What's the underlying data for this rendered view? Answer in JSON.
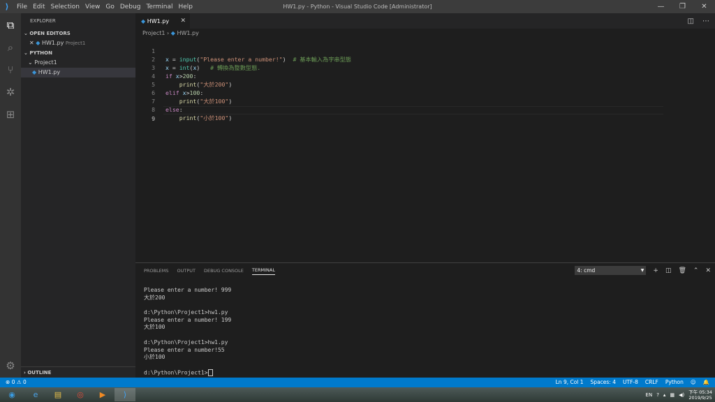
{
  "window": {
    "title": "HW1.py - Python - Visual Studio Code [Administrator]",
    "menu": [
      "File",
      "Edit",
      "Selection",
      "View",
      "Go",
      "Debug",
      "Terminal",
      "Help"
    ]
  },
  "sidebar": {
    "title": "EXPLORER",
    "open_editors_label": "OPEN EDITORS",
    "open_file": "HW1.py",
    "open_file_folder": "Project1",
    "workspace_label": "PYTHON",
    "folder": "Project1",
    "file": "HW1.py",
    "outline_label": "OUTLINE"
  },
  "tab": {
    "label": "HW1.py"
  },
  "breadcrumb": {
    "folder": "Project1",
    "file": "HW1.py"
  },
  "code_lines": [
    {
      "n": "1"
    },
    {
      "n": "2"
    },
    {
      "n": "3"
    },
    {
      "n": "4"
    },
    {
      "n": "5"
    },
    {
      "n": "6"
    },
    {
      "n": "7"
    },
    {
      "n": "8"
    },
    {
      "n": "9"
    }
  ],
  "code": {
    "l1_var": "x",
    "l1_eq": " = ",
    "l1_fn": "input",
    "l1_p1": "(",
    "l1_str": "\"Please enter a number!\"",
    "l1_p2": ")",
    "l1_sp": "  ",
    "l1_cmt": "# 基本輸入為字串型態",
    "l2_var": "x",
    "l2_eq": " = ",
    "l2_fn": "int",
    "l2_p1": "(",
    "l2_arg": "x",
    "l2_p2": ")",
    "l2_sp": "   ",
    "l2_cmt": "# 轉換為整數型態.",
    "l3_kw": "if",
    "l3_sp": " ",
    "l3_var": "x",
    "l3_op": ">",
    "l3_num": "200",
    "l3_colon": ":",
    "l4_ind": "    ",
    "l4_fn": "print",
    "l4_p1": "(",
    "l4_str": "\"大於200\"",
    "l4_p2": ")",
    "l5_kw": "elif",
    "l5_sp": " ",
    "l5_var": "x",
    "l5_op": ">",
    "l5_num": "100",
    "l5_colon": ":",
    "l6_ind": "    ",
    "l6_fn": "print",
    "l6_p1": "(",
    "l6_str": "\"大於100\"",
    "l6_p2": ")",
    "l7_kw": "else",
    "l7_colon": ":",
    "l8_ind": "    ",
    "l8_fn": "print",
    "l8_p1": "(",
    "l8_str": "\"小於100\"",
    "l8_p2": ")"
  },
  "panel": {
    "tabs": [
      "PROBLEMS",
      "OUTPUT",
      "DEBUG CONSOLE",
      "TERMINAL"
    ],
    "terminal_select": "4: cmd",
    "terminal_lines": [
      "Please enter a number! 999",
      "大於200",
      "",
      "d:\\Python\\Project1>hw1.py",
      "Please enter a number! 199",
      "大於100",
      "",
      "d:\\Python\\Project1>hw1.py",
      "Please enter a number!55",
      "小於100",
      "",
      "d:\\Python\\Project1>"
    ]
  },
  "status": {
    "errors": "0",
    "warnings": "0",
    "position": "Ln 9, Col 1",
    "spaces": "Spaces: 4",
    "encoding": "UTF-8",
    "eol": "CRLF",
    "language": "Python"
  },
  "taskbar": {
    "lang": "EN",
    "time": "下午 05:34",
    "date": "2019/9/25"
  },
  "colors": {
    "statusbar": "#007acc",
    "keyword": "#c586c0",
    "function": "#dcdcaa",
    "string": "#ce9178",
    "comment": "#6a9955",
    "builtin": "#4ec9b0",
    "number": "#b5cea8"
  }
}
